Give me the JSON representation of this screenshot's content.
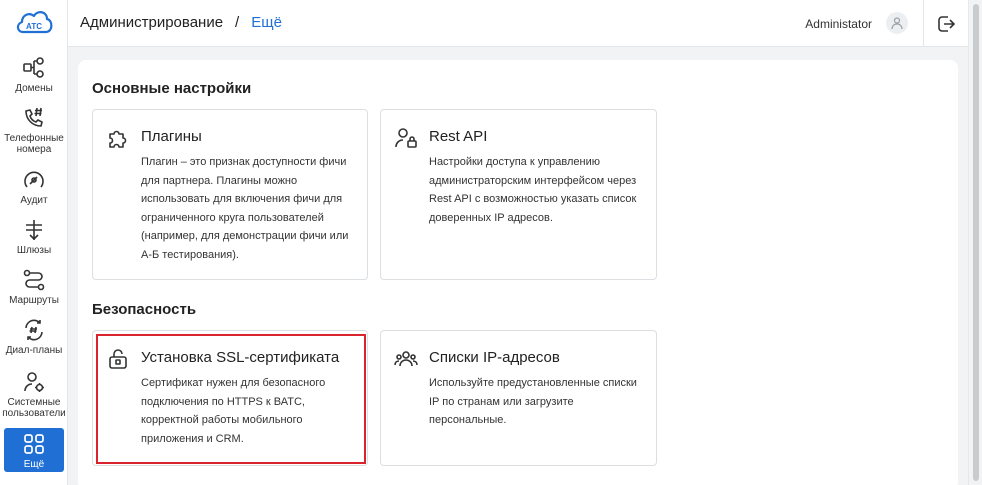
{
  "sidebar": {
    "logo_text": "АТС",
    "items": [
      {
        "label": "Домены",
        "icon": "domains-icon"
      },
      {
        "label": "Телефонные\nномера",
        "icon": "phone-hash-icon"
      },
      {
        "label": "Аудит",
        "icon": "audit-icon"
      },
      {
        "label": "Шлюзы",
        "icon": "gateway-icon"
      },
      {
        "label": "Маршруты",
        "icon": "routes-icon"
      },
      {
        "label": "Диал-планы",
        "icon": "dialplan-icon"
      },
      {
        "label": "Системные\nпользователи",
        "icon": "system-users-icon"
      },
      {
        "label": "Ещё",
        "icon": "more-grid-icon",
        "active": true
      }
    ]
  },
  "header": {
    "breadcrumb_root": "Администрирование",
    "breadcrumb_sep": "/",
    "breadcrumb_current": "Ещё",
    "user_name": "Administator"
  },
  "sections": [
    {
      "title": "Основные настройки",
      "cards": [
        {
          "title": "Плагины",
          "icon": "puzzle-icon",
          "desc": "Плагин – это признак доступности фичи для партнера. Плагины можно использовать для включения фичи для ограниченного круга пользователей (например, для демонстрации фичи или А-Б тестирования)."
        },
        {
          "title": "Rest API",
          "icon": "user-lock-icon",
          "desc": "Настройки доступа к управлению администраторским интерфейсом через Rest API с возможностью указать список доверенных IP адресов."
        }
      ]
    },
    {
      "title": "Безопасность",
      "cards": [
        {
          "title": "Установка SSL-сертификата",
          "icon": "lock-icon",
          "desc": "Сертификат нужен для безопасного подключения по HTTPS к ВАТС, корректной работы мобильного приложения и CRM."
        },
        {
          "title": "Списки IP-адресов",
          "icon": "users-group-icon",
          "desc": "Используйте предустановленные списки IP по странам или загрузите персональные."
        }
      ]
    }
  ],
  "colors": {
    "accent": "#1f6fd4",
    "highlight": "#d9232d"
  }
}
